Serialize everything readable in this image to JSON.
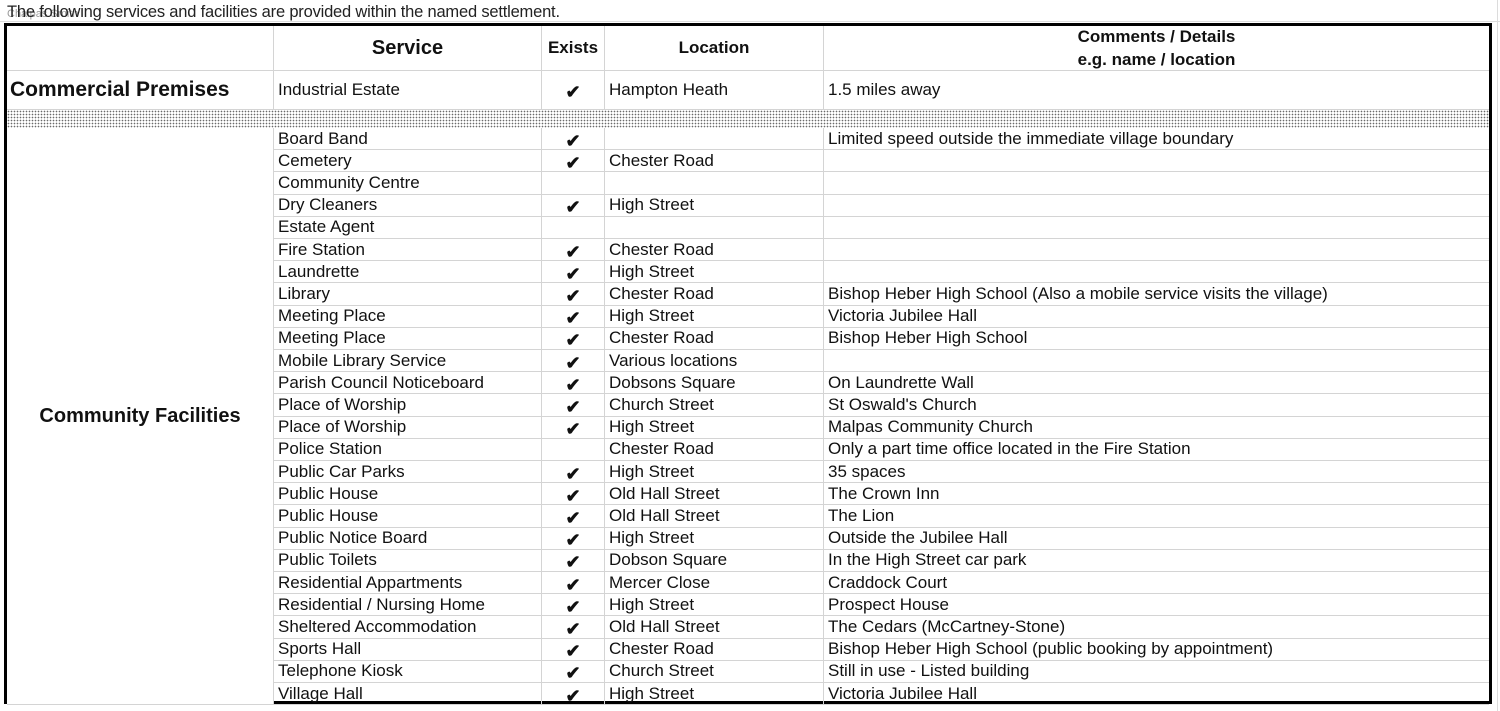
{
  "intro_text": "The following services and facilities are provided within the named settlement.",
  "ghost_text": "Chalpas Smith",
  "table": {
    "headers": {
      "category": "",
      "service": "Service",
      "exists": "Exists",
      "location": "Location",
      "comments_line1": "Comments / Details",
      "comments_line2": "e.g. name / location"
    },
    "commercial": {
      "category": "Commercial Premises",
      "service": "Industrial Estate",
      "exists": "✔",
      "location": "Hampton Heath",
      "comments": "1.5 miles away"
    },
    "community": {
      "category": "Community Facilities",
      "rows": [
        {
          "service": "Board Band",
          "exists": "✔",
          "location": "",
          "comments": "Limited speed outside the immediate village boundary"
        },
        {
          "service": "Cemetery",
          "exists": "✔",
          "location": "Chester Road",
          "comments": ""
        },
        {
          "service": "Community Centre",
          "exists": "",
          "location": "",
          "comments": ""
        },
        {
          "service": "Dry Cleaners",
          "exists": "✔",
          "location": "High Street",
          "comments": ""
        },
        {
          "service": "Estate Agent",
          "exists": "",
          "location": "",
          "comments": ""
        },
        {
          "service": "Fire Station",
          "exists": "✔",
          "location": "Chester Road",
          "comments": ""
        },
        {
          "service": "Laundrette",
          "exists": "✔",
          "location": "High Street",
          "comments": ""
        },
        {
          "service": "Library",
          "exists": "✔",
          "location": "Chester Road",
          "comments": "Bishop Heber High School (Also a mobile service visits the village)"
        },
        {
          "service": "Meeting Place",
          "exists": "✔",
          "location": "High Street",
          "comments": "Victoria Jubilee Hall"
        },
        {
          "service": "Meeting Place",
          "exists": "✔",
          "location": "Chester Road",
          "comments": "Bishop Heber High School"
        },
        {
          "service": "Mobile Library Service",
          "exists": "✔",
          "location": "Various locations",
          "comments": ""
        },
        {
          "service": "Parish Council Noticeboard",
          "exists": "✔",
          "location": "Dobsons Square",
          "comments": "On Laundrette Wall"
        },
        {
          "service": "Place of Worship",
          "exists": "✔",
          "location": "Church Street",
          "comments": "St Oswald's Church"
        },
        {
          "service": "Place of Worship",
          "exists": "✔",
          "location": "High Street",
          "comments": "Malpas Community Church"
        },
        {
          "service": "Police Station",
          "exists": "",
          "location": "Chester Road",
          "comments": "Only a part time office located in the Fire Station"
        },
        {
          "service": "Public Car Parks",
          "exists": "✔",
          "location": "High Street",
          "comments": "35 spaces"
        },
        {
          "service": "Public House",
          "exists": "✔",
          "location": "Old Hall Street",
          "comments": "The Crown Inn"
        },
        {
          "service": "Public House",
          "exists": "✔",
          "location": "Old Hall Street",
          "comments": "The Lion"
        },
        {
          "service": "Public Notice Board",
          "exists": "✔",
          "location": "High Street",
          "comments": "Outside the Jubilee Hall"
        },
        {
          "service": "Public Toilets",
          "exists": "✔",
          "location": "Dobson Square",
          "comments": "In the High Street car park"
        },
        {
          "service": "Residential Appartments",
          "exists": "✔",
          "location": "Mercer Close",
          "comments": "Craddock Court"
        },
        {
          "service": "Residential / Nursing Home",
          "exists": "✔",
          "location": "High Street",
          "comments": "Prospect House"
        },
        {
          "service": "Sheltered Accommodation",
          "exists": "✔",
          "location": "Old Hall Street",
          "comments": "The Cedars (McCartney-Stone)"
        },
        {
          "service": "Sports Hall",
          "exists": "✔",
          "location": "Chester Road",
          "comments": "Bishop Heber High School (public booking by appointment)"
        },
        {
          "service": "Telephone Kiosk",
          "exists": "✔",
          "location": "Church Street",
          "comments": "Still in use - Listed building"
        },
        {
          "service": "Village Hall",
          "exists": "✔",
          "location": "High Street",
          "comments": "Victoria Jubilee Hall"
        }
      ]
    }
  }
}
